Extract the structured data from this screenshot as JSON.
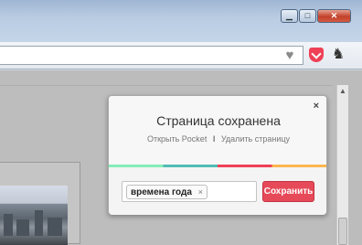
{
  "window": {
    "minimize_glyph": "▁",
    "maximize_glyph": "□",
    "close_glyph": "✕"
  },
  "toolbar": {
    "heart_icon": "♥",
    "extension_icon": "♞"
  },
  "pocket_panel": {
    "close_glyph": "×",
    "title": "Страница сохранена",
    "open_link": "Открыть Pocket",
    "separator": "I",
    "remove_link": "Удалить страницу",
    "tag": "времена года",
    "tag_remove": "×",
    "save_button": "Сохранить",
    "stripe_colors": [
      "#83edb8",
      "#50bcb6",
      "#ef4056",
      "#fcb64f"
    ],
    "accent_color": "#e64a59"
  },
  "scrollbar": {
    "up_arrow": "▲"
  }
}
